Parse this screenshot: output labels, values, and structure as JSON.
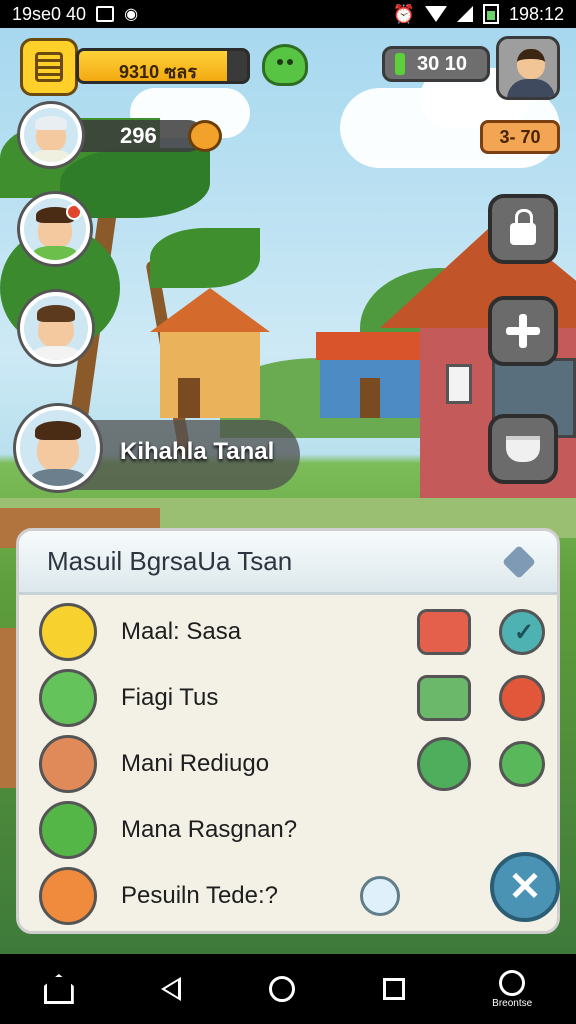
{
  "status_bar": {
    "left_text": "19se0 40",
    "time": "198:12"
  },
  "hud": {
    "xp_text": "9310 ซลร",
    "xp_progress": 0.88,
    "cash_text": "30 10",
    "score": "296",
    "level_badge": "3- 70"
  },
  "player": {
    "name": "Kihahla Tanal"
  },
  "panel": {
    "title": "Masuil BgrsaUa  Tsan",
    "items": [
      {
        "label": "Maal: Sasa",
        "icon_color": "#f7d12e",
        "square_color": "#e4604a",
        "bubble_color": "#4fb2b2"
      },
      {
        "label": "Fiagi Tus",
        "icon_color": "#64c35a",
        "square_color": "#6bb86b",
        "bubble_color": "#e2573a"
      },
      {
        "label": "Mani Rediugo",
        "icon_color": "#e08a5a",
        "square_color": "#4fae5c",
        "bubble_color": "#58b85a"
      },
      {
        "label": "Mana Rasgnan?",
        "icon_color": "#55b648",
        "square_color": "",
        "bubble_color": ""
      },
      {
        "label": "Pesuiln Tede:?",
        "icon_color": "#f08a3c",
        "square_color": "",
        "bubble_color": ""
      }
    ]
  },
  "nav": {
    "search_caption": "Breontse"
  },
  "icons": {
    "menu": "menu-icon",
    "slime": "slime-pet-icon",
    "cash": "cash-icon",
    "lock": "lock-icon",
    "plus": "plus-icon",
    "cup": "cup-icon",
    "close": "close-icon",
    "settings": "settings-gem-icon"
  }
}
